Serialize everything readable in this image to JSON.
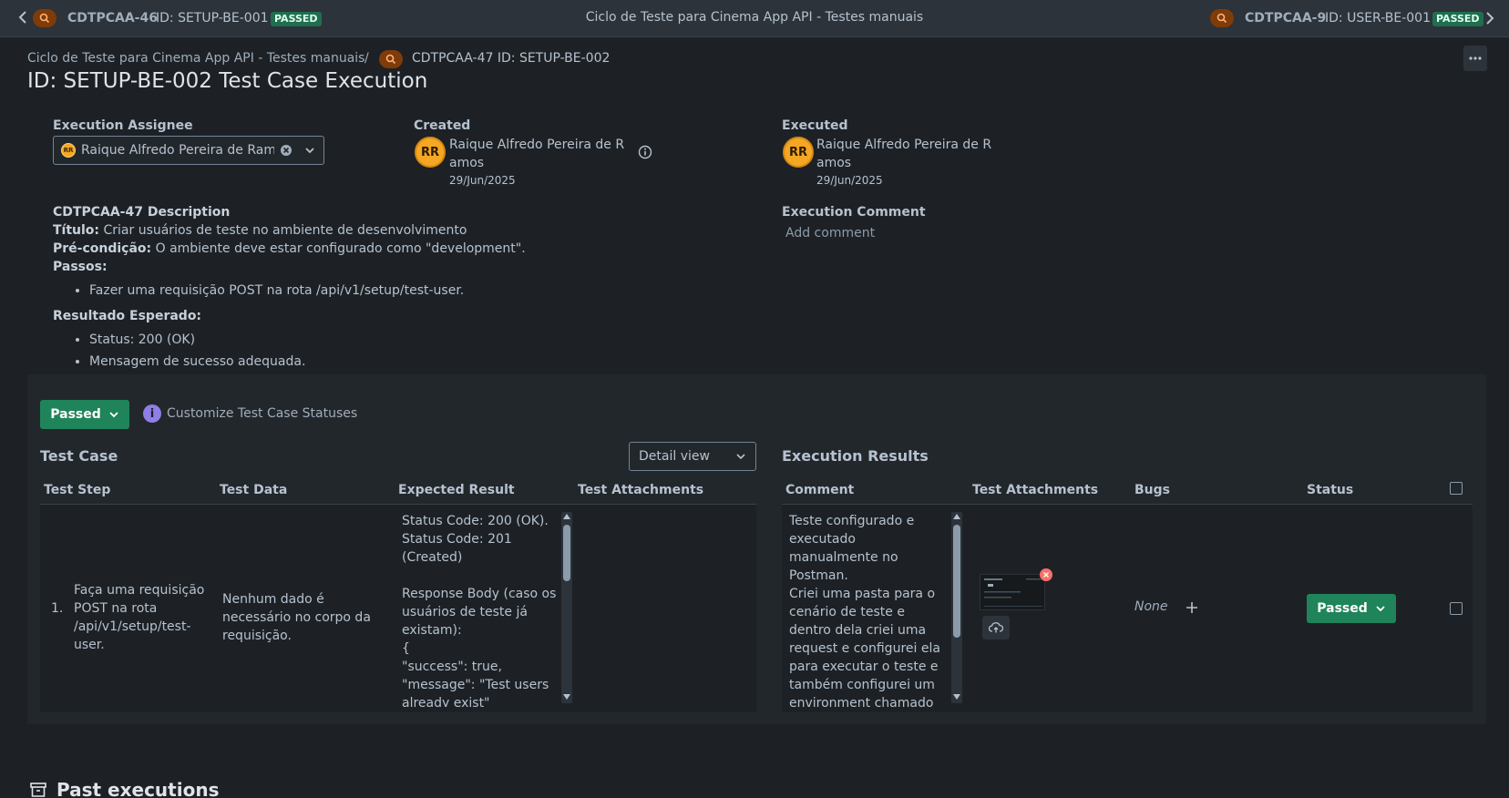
{
  "topbar": {
    "prev": {
      "key": "CDTPCAA-46",
      "id": "ID: SETUP-BE-001",
      "status": "PASSED"
    },
    "center_title": "Ciclo de Teste para Cinema App API - Testes manuais",
    "next": {
      "key": "CDTPCAA-9",
      "id": "ID: USER-BE-001",
      "status": "PASSED"
    }
  },
  "breadcrumb": {
    "parent": "Ciclo de Teste para Cinema App API - Testes manuais",
    "separator": "/",
    "current": "CDTPCAA-47 ID: SETUP-BE-002"
  },
  "page_title": "ID: SETUP-BE-002 Test Case Execution",
  "assignee": {
    "label": "Execution Assignee",
    "value": "Raique Alfredo Pereira de Ram",
    "avatar_initials": "RR"
  },
  "created": {
    "label": "Created",
    "initials": "RR",
    "name": "Raique Alfredo Pereira de Ramos",
    "date": "29/Jun/2025"
  },
  "executed": {
    "label": "Executed",
    "initials": "RR",
    "name": "Raique Alfredo Pereira de Ramos",
    "date": "29/Jun/2025"
  },
  "description": {
    "heading": "CDTPCAA-47 Description",
    "titulo_label": "Título:",
    "titulo": "Criar usuários de teste no ambiente de desenvolvimento",
    "precondicao_label": "Pré-condição:",
    "precondicao": "O ambiente deve estar configurado como \"development\".",
    "passos_label": "Passos:",
    "passos": [
      "Fazer uma requisição POST na rota /api/v1/setup/test-user."
    ],
    "resultado_label": "Resultado Esperado:",
    "resultado": [
      "Status: 200 (OK)",
      "Mensagem de sucesso adequada."
    ]
  },
  "execution_comment": {
    "label": "Execution Comment",
    "placeholder": "Add comment"
  },
  "status_button": "Passed",
  "customize_link": "Customize Test Case Statuses",
  "test_case": {
    "title": "Test Case",
    "view_select": "Detail view",
    "columns": [
      "Test Step",
      "Test Data",
      "Expected Result",
      "Test Attachments"
    ],
    "row": {
      "num": "1.",
      "step": "Faça uma requisição POST na rota /api/v1/setup/test-user.",
      "data": "Nenhum dado é necessário no corpo da requisição.",
      "expected": "Status Code: 200 (OK).\nStatus Code: 201 (Created)\n\nResponse Body (caso os usuários de teste já existam):\n{\n\"success\": true,\n\"message\": \"Test users already exist\""
    }
  },
  "execution_results": {
    "title": "Execution Results",
    "columns": [
      "Comment",
      "Test Attachments",
      "Bugs",
      "Status"
    ],
    "row": {
      "comment": "Teste configurado e executado manualmente no Postman.\nCriei uma pasta para o cenário de teste e dentro dela criei uma request e configurei ela para executar o teste e também configurei um environment chamado \"Development\" para",
      "bugs": "None",
      "status": "Passed"
    }
  },
  "past_executions": "Past executions",
  "colors": {
    "passed": "#1f845a",
    "lozenge": "#216e4e",
    "avatar": "#f5a623",
    "search_badge": "#7f3b08"
  }
}
